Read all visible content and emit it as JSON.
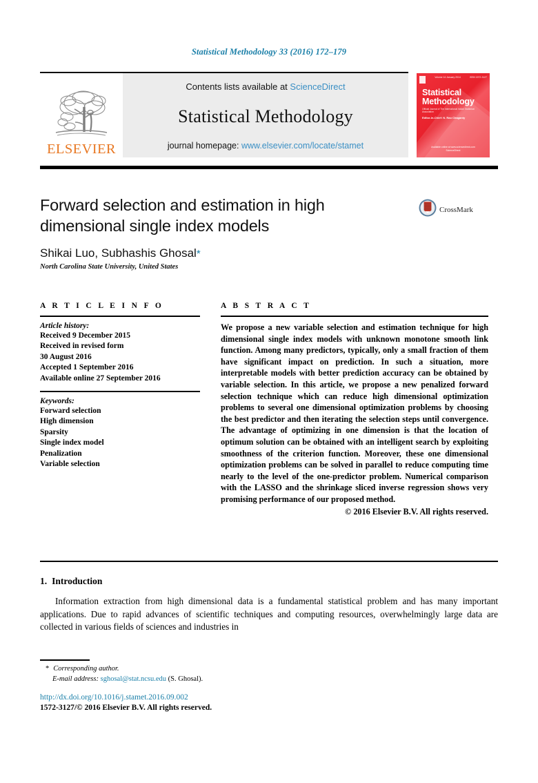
{
  "running_head": "Statistical Methodology 33 (2016) 172–179",
  "masthead": {
    "publisher_logo_name": "elsevier-tree-logo",
    "publisher_wordmark": "ELSEVIER",
    "contents_prefix": "Contents lists available at",
    "contents_link": "ScienceDirect",
    "journal_name": "Statistical Methodology",
    "homepage_prefix": "journal homepage:",
    "homepage_link": "www.elsevier.com/locate/stamet"
  },
  "cover": {
    "volume_line": "Volume 14  January 2014",
    "issn_line": "ISSN 1572-3127",
    "title_line_1": "Statistical",
    "title_line_2": "Methodology",
    "subtitle": "Official Journal of The International Indian Statistical Association",
    "editor": "Editor-in-Chief: N. Rao Chaganty",
    "bottom_line_1": "Available online at www.sciencedirect.com",
    "bottom_line_2": "ScienceDirect"
  },
  "article": {
    "title": "Forward selection and estimation in high dimensional single index models",
    "authors": "Shikai Luo, Subhashis Ghosal",
    "corresponding_marker": "*",
    "affiliation": "North Carolina State University, United States",
    "crossmark_label": "CrossMark"
  },
  "info": {
    "heading": "A R T I C L E   I N F O",
    "history_label": "Article history:",
    "history": [
      "Received 9 December 2015",
      "Received in revised form",
      "30 August 2016",
      "Accepted 1 September 2016",
      "Available online 27 September 2016"
    ],
    "keywords_label": "Keywords:",
    "keywords": [
      "Forward selection",
      "High dimension",
      "Sparsity",
      "Single index model",
      "Penalization",
      "Variable selection"
    ]
  },
  "abstract": {
    "heading": "A B S T R A C T",
    "body": "We propose a new variable selection and estimation technique for high dimensional single index models with unknown monotone smooth link function. Among many predictors, typically, only a small fraction of them have significant impact on prediction. In such a situation, more interpretable models with better prediction accuracy can be obtained by variable selection. In this article, we propose a new penalized forward selection technique which can reduce high dimensional optimization problems to several one dimensional optimization problems by choosing the best predictor and then iterating the selection steps until convergence. The advantage of optimizing in one dimension is that the location of optimum solution can be obtained with an intelligent search by exploiting smoothness of the criterion function. Moreover, these one dimensional optimization problems can be solved in parallel to reduce computing time nearly to the level of the one-predictor problem. Numerical comparison with the LASSO and the shrinkage sliced inverse regression shows very promising performance of our proposed method.",
    "copyright": "© 2016 Elsevier B.V. All rights reserved."
  },
  "introduction": {
    "number": "1.",
    "heading": "Introduction",
    "paragraph": "Information extraction from high dimensional data is a fundamental statistical problem and has many important applications. Due to rapid advances of scientific techniques and computing resources, overwhelmingly large data are collected in various fields of sciences and industries in"
  },
  "footnotes": {
    "corresponding_marker": "*",
    "corresponding_text": "Corresponding author.",
    "email_label": "E-mail address:",
    "email": "sghosal@stat.ncsu.edu",
    "email_owner": "(S. Ghosal).",
    "doi": "http://dx.doi.org/10.1016/j.stamet.2016.09.002",
    "issn_copyright": "1572-3127/© 2016 Elsevier B.V. All rights reserved."
  },
  "colors": {
    "link": "#1a7fa8",
    "masthead_link": "#3a8fc4",
    "elsevier_orange": "#E87722",
    "cover_red": "#ef2b35"
  }
}
